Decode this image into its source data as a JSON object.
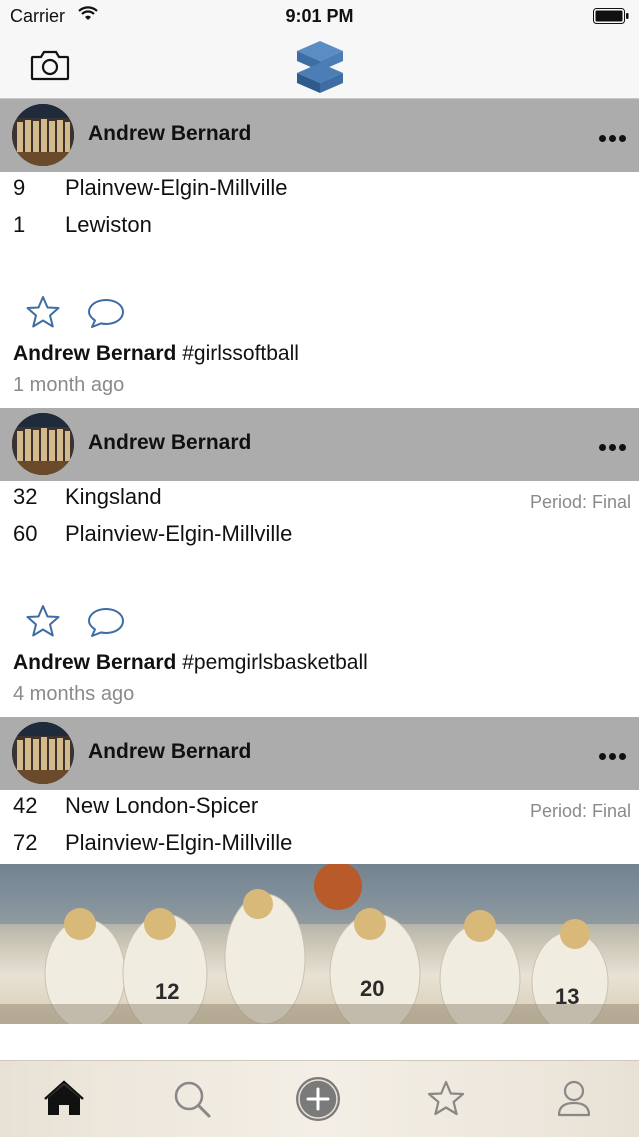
{
  "status_bar": {
    "carrier": "Carrier",
    "time": "9:01 PM"
  },
  "nav": {
    "camera_icon": "camera-icon",
    "logo_icon": "app-logo"
  },
  "posts": [
    {
      "author": "Andrew Bernard",
      "scores": [
        {
          "score": "9",
          "team": "Plainvew-Elgin-Millville"
        },
        {
          "score": "1",
          "team": "Lewiston"
        }
      ],
      "period": "",
      "hashtag": "#girlssoftball",
      "time": "1 month ago"
    },
    {
      "author": "Andrew Bernard",
      "scores": [
        {
          "score": "32",
          "team": "Kingsland"
        },
        {
          "score": "60",
          "team": "Plainview-Elgin-Millville"
        }
      ],
      "period": "Period: Final",
      "hashtag": "#pemgirlsbasketball",
      "time": "4 months ago"
    },
    {
      "author": "Andrew Bernard",
      "scores": [
        {
          "score": "42",
          "team": "New London-Spicer"
        },
        {
          "score": "72",
          "team": "Plainview-Elgin-Millville"
        }
      ],
      "period": "Period: Final"
    }
  ],
  "tabs": [
    "home-icon",
    "search-icon",
    "add-icon",
    "star-icon",
    "profile-icon"
  ],
  "colors": {
    "header_gray": "#acacac",
    "logo_blue": "#3e6da4",
    "muted_text": "#8a8a8a"
  }
}
